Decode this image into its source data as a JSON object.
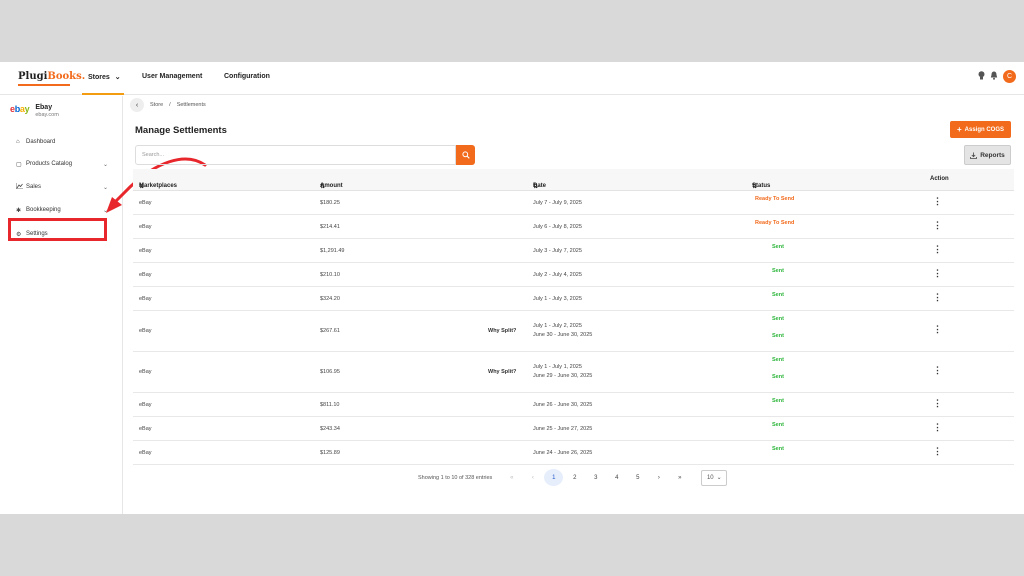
{
  "brand": {
    "logo_main": "Plugi",
    "logo_accent": "Books."
  },
  "topnav": {
    "stores": "Stores",
    "user_management": "User Management",
    "configuration": "Configuration",
    "avatar_initial": "C"
  },
  "sidebar": {
    "store_name": "Ebay",
    "store_domain": "ebay.com",
    "items": [
      {
        "label": "Dashboard",
        "icon": "home-icon"
      },
      {
        "label": "Products Catalog",
        "icon": "box-icon"
      },
      {
        "label": "Sales",
        "icon": "chart-icon"
      },
      {
        "label": "Bookkeeping",
        "icon": "book-icon"
      },
      {
        "label": "Settings",
        "icon": "gear-icon"
      }
    ]
  },
  "breadcrumb": {
    "store": "Store",
    "sep": "/",
    "current": "Settlements"
  },
  "page": {
    "title": "Manage Settlements",
    "assign_cogs": "Assign COGS",
    "reports": "Reports",
    "search_placeholder": "Search..."
  },
  "table": {
    "headers": {
      "marketplaces": "Marketplaces",
      "amount": "Amount",
      "date": "Date",
      "status": "Status",
      "action": "Action"
    },
    "rows": [
      {
        "marketplace": "eBay",
        "amount": "$180.25",
        "date1": "July 7 - July 9, 2025",
        "date2": "",
        "why": "",
        "status1": "Ready To Send",
        "status2": ""
      },
      {
        "marketplace": "eBay",
        "amount": "$214.41",
        "date1": "July 6 - July 8, 2025",
        "date2": "",
        "why": "",
        "status1": "Ready To Send",
        "status2": ""
      },
      {
        "marketplace": "eBay",
        "amount": "$1,291.49",
        "date1": "July 3 - July 7, 2025",
        "date2": "",
        "why": "",
        "status1": "Sent",
        "status2": ""
      },
      {
        "marketplace": "eBay",
        "amount": "$210.10",
        "date1": "July 2 - July 4, 2025",
        "date2": "",
        "why": "",
        "status1": "Sent",
        "status2": ""
      },
      {
        "marketplace": "eBay",
        "amount": "$324.20",
        "date1": "July 1 - July 3, 2025",
        "date2": "",
        "why": "",
        "status1": "Sent",
        "status2": ""
      },
      {
        "marketplace": "eBay",
        "amount": "$267.61",
        "date1": "July 1 - July 2, 2025",
        "date2": "June 30 - June 30, 2025",
        "why": "Why Split?",
        "status1": "Sent",
        "status2": "Sent"
      },
      {
        "marketplace": "eBay",
        "amount": "$106.95",
        "date1": "July 1 - July 1, 2025",
        "date2": "June 29 - June 30, 2025",
        "why": "Why Split?",
        "status1": "Sent",
        "status2": "Sent"
      },
      {
        "marketplace": "eBay",
        "amount": "$811.10",
        "date1": "June 26 - June 30, 2025",
        "date2": "",
        "why": "",
        "status1": "Sent",
        "status2": ""
      },
      {
        "marketplace": "eBay",
        "amount": "$243.34",
        "date1": "June 25 - June 27, 2025",
        "date2": "",
        "why": "",
        "status1": "Sent",
        "status2": ""
      },
      {
        "marketplace": "eBay",
        "amount": "$125.89",
        "date1": "June 24 - June 26, 2025",
        "date2": "",
        "why": "",
        "status1": "Sent",
        "status2": ""
      }
    ]
  },
  "pagination": {
    "summary": "Showing 1 to 10 of 328 entries",
    "pages": [
      "1",
      "2",
      "3",
      "4",
      "5"
    ],
    "current": "1",
    "per_page": "10"
  },
  "colors": {
    "accent": "#f26a1b",
    "sent": "#2cb53a",
    "highlight": "#e8272d"
  }
}
